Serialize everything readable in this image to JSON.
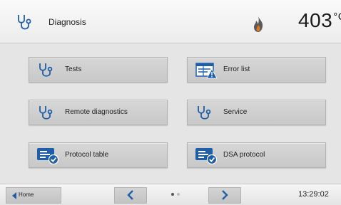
{
  "header": {
    "title": "Diagnosis",
    "icon": "stethoscope-icon",
    "status_icon": "flame-icon",
    "temperature": "403",
    "temperature_unit": "°C"
  },
  "tiles": [
    {
      "label": "Tests",
      "icon": "stethoscope-icon"
    },
    {
      "label": "Error list",
      "icon": "error-list-icon"
    },
    {
      "label": "Remote diagnostics",
      "icon": "stethoscope-icon"
    },
    {
      "label": "Service",
      "icon": "stethoscope-icon"
    },
    {
      "label": "Protocol table",
      "icon": "protocol-icon"
    },
    {
      "label": "DSA protocol",
      "icon": "protocol-icon"
    }
  ],
  "footer": {
    "home_label": "Home",
    "page_index": 1,
    "page_count": 2,
    "time": "13:29:02"
  },
  "colors": {
    "accent_blue": "#1f5fa8",
    "background": "#e6e6e6",
    "tile": "#cfcfcf"
  }
}
